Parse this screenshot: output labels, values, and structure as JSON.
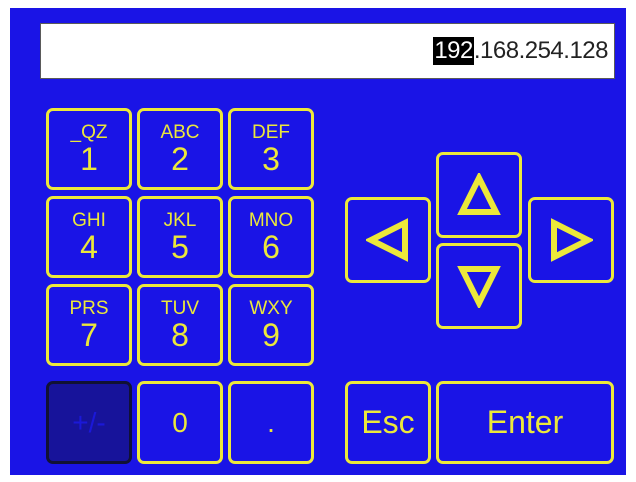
{
  "display": {
    "selected_octet": "192",
    "rest": ".168.254.128"
  },
  "keypad": [
    {
      "sub": "_QZ",
      "main": "1"
    },
    {
      "sub": "ABC",
      "main": "2"
    },
    {
      "sub": "DEF",
      "main": "3"
    },
    {
      "sub": "GHI",
      "main": "4"
    },
    {
      "sub": "JKL",
      "main": "5"
    },
    {
      "sub": "MNO",
      "main": "6"
    },
    {
      "sub": "PRS",
      "main": "7"
    },
    {
      "sub": "TUV",
      "main": "8"
    },
    {
      "sub": "WXY",
      "main": "9"
    }
  ],
  "bottom_keys": {
    "sign": "+/-",
    "zero": "0",
    "dot": "."
  },
  "actions": {
    "esc": "Esc",
    "enter": "Enter"
  },
  "icons": {
    "up": "arrow-up-icon",
    "down": "arrow-down-icon",
    "left": "arrow-left-icon",
    "right": "arrow-right-icon"
  },
  "colors": {
    "background": "#1a14e6",
    "accent": "#ece83a",
    "disabled": "#17139a"
  }
}
